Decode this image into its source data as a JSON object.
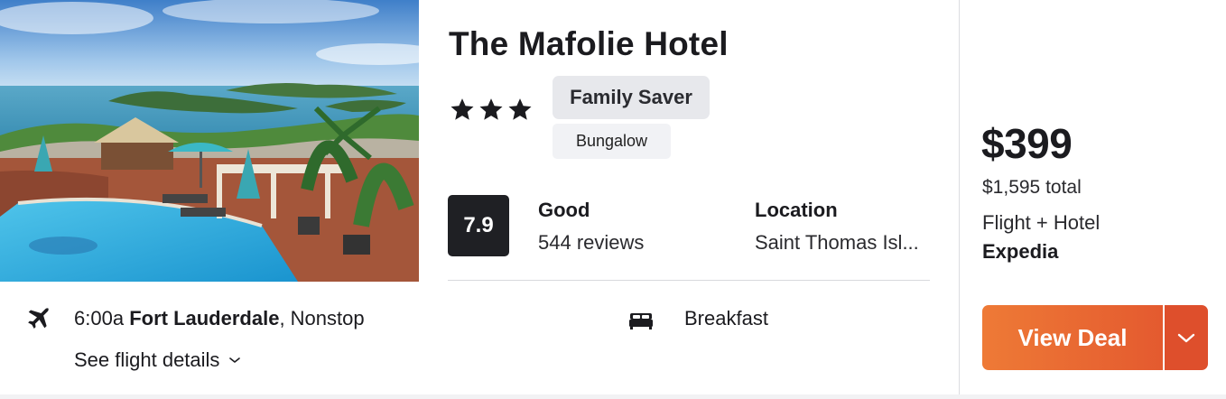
{
  "hotel": {
    "name": "The Mafolie Hotel",
    "star_rating": 3,
    "badges": {
      "primary": "Family Saver",
      "secondary": "Bungalow"
    },
    "score": "7.9",
    "rating_word": "Good",
    "review_count": "544 reviews",
    "location_label": "Location",
    "location_value": "Saint Thomas Isl..."
  },
  "flight": {
    "time": "6:00a",
    "origin": "Fort Lauderdale",
    "stops": ", Nonstop",
    "details_label": "See flight details"
  },
  "amenity": {
    "label": "Breakfast"
  },
  "price": {
    "per_person": "$399",
    "total": "$1,595 total",
    "package": "Flight + Hotel",
    "provider": "Expedia",
    "button_label": "View Deal"
  },
  "colors": {
    "accent_start": "#ee7a36",
    "accent_end": "#e45a2f",
    "score_bg": "#1f2024"
  },
  "icons": {
    "flight": "airplane-icon",
    "amenity": "bed-icon",
    "details_chevron": "chevron-down-icon",
    "deal_dropdown": "chevron-down-icon",
    "star": "star-icon"
  }
}
